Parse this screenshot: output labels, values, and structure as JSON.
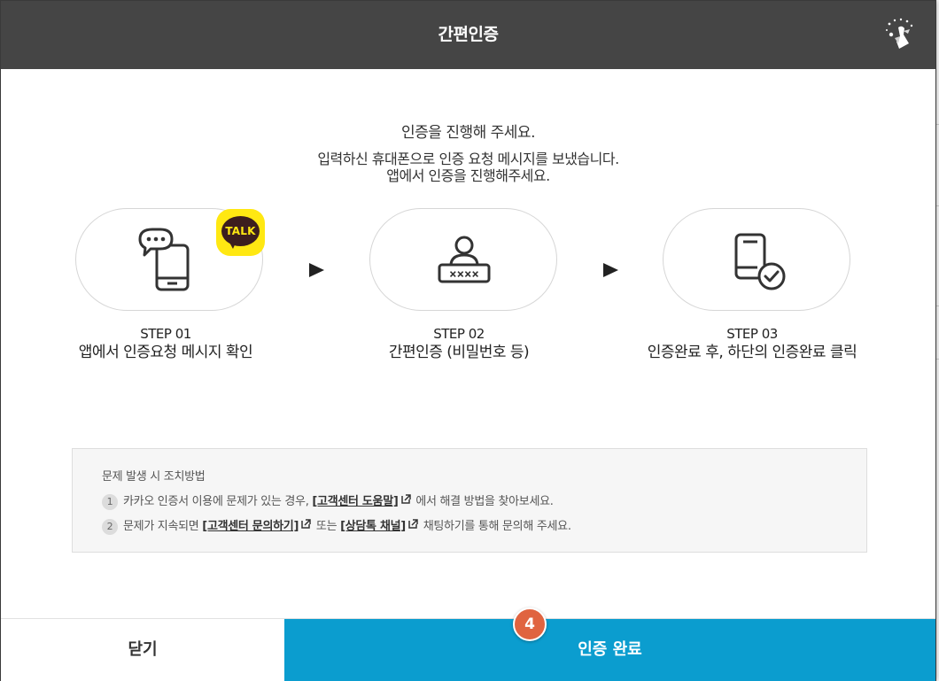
{
  "modal": {
    "title": "간편인증",
    "intro_line1": "인증을 진행해 주세요.",
    "intro_line2": "입력하신 휴대폰으로 인증 요청 메시지를 보냈습니다.",
    "intro_line3": "앱에서 인증을 진행해주세요."
  },
  "steps": [
    {
      "number": "STEP 01",
      "description": "앱에서 인증요청 메시지 확인",
      "icon": "chat-phone-icon"
    },
    {
      "number": "STEP 02",
      "description": "간편인증 (비밀번호 등)",
      "icon": "user-password-icon"
    },
    {
      "number": "STEP 03",
      "description": "인증완료 후, 하단의 인증완료 클릭",
      "icon": "phone-check-icon"
    }
  ],
  "talk_badge": {
    "text": "TALK",
    "color": "#ffe812"
  },
  "help": {
    "title": "문제 발생 시 조치방법",
    "items": [
      {
        "num": "1",
        "before": "카카오 인증서 이용에 문제가 있는 경우, ",
        "link1": "[고객센터 도움말]",
        "after": " 에서 해결 방법을 찾아보세요."
      },
      {
        "num": "2",
        "before": "문제가 지속되면 ",
        "link1": "[고객센터 문의하기]",
        "middle": " 또는 ",
        "link2": "[상담톡 채널]",
        "after": " 채팅하기를 통해 문의해 주세요."
      }
    ]
  },
  "footer": {
    "close_label": "닫기",
    "done_label": "인증 완료",
    "accent_color": "#0b9dcf"
  },
  "marker": {
    "label": "4"
  }
}
